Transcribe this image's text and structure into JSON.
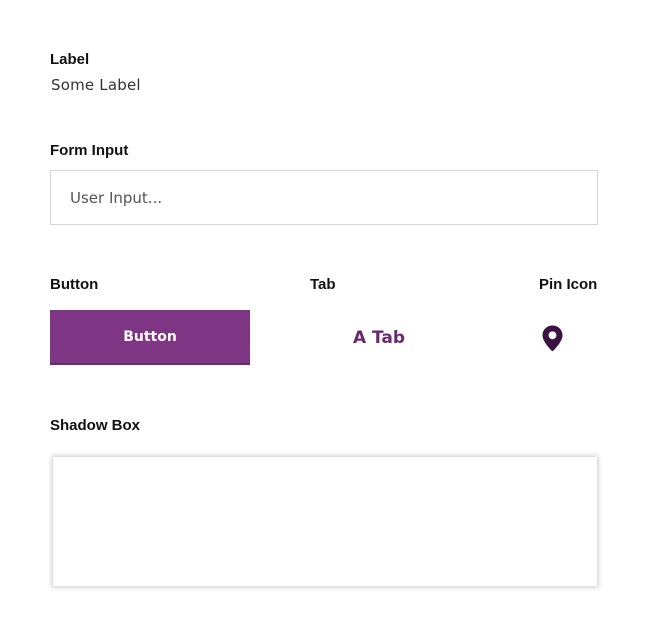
{
  "colors": {
    "brand_purple": "#7e3584",
    "tab_text": "#6a2a6e",
    "pin_icon": "#3b1240"
  },
  "label_section": {
    "heading": "Label",
    "value": "Some Label"
  },
  "form_input_section": {
    "heading": "Form Input",
    "placeholder": "User Input..."
  },
  "button_section": {
    "heading": "Button",
    "button_label": "Button"
  },
  "tab_section": {
    "heading": "Tab",
    "tab_label": "A Tab"
  },
  "pin_section": {
    "heading": "Pin Icon",
    "icon": "map-pin-icon"
  },
  "shadow_box_section": {
    "heading": "Shadow Box"
  }
}
